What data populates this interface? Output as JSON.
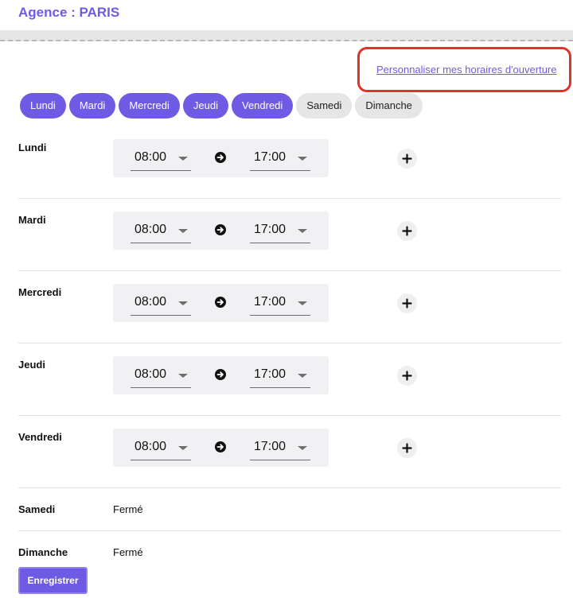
{
  "header": {
    "agency_title": "Agence : PARIS"
  },
  "customize_link": "Personnaliser mes horaires d'ouverture",
  "day_chips": [
    {
      "label": "Lundi",
      "active": true
    },
    {
      "label": "Mardi",
      "active": true
    },
    {
      "label": "Mercredi",
      "active": true
    },
    {
      "label": "Jeudi",
      "active": true
    },
    {
      "label": "Vendredi",
      "active": true
    },
    {
      "label": "Samedi",
      "active": false
    },
    {
      "label": "Dimanche",
      "active": false
    }
  ],
  "schedule": [
    {
      "day": "Lundi",
      "open": "08:00",
      "close": "17:00"
    },
    {
      "day": "Mardi",
      "open": "08:00",
      "close": "17:00"
    },
    {
      "day": "Mercredi",
      "open": "08:00",
      "close": "17:00"
    },
    {
      "day": "Jeudi",
      "open": "08:00",
      "close": "17:00"
    },
    {
      "day": "Vendredi",
      "open": "08:00",
      "close": "17:00"
    }
  ],
  "closed_days": [
    {
      "day": "Samedi",
      "status": "Fermé"
    },
    {
      "day": "Dimanche",
      "status": "Fermé"
    }
  ],
  "save_label": "Enregistrer",
  "icons": {
    "time_separator": "arrow-right-circle-icon",
    "add_slot": "plus-icon",
    "dropdown": "caret-down-icon"
  },
  "colors": {
    "accent": "#6f5be3",
    "highlight": "#e0312a",
    "chip_inactive": "#e6e6e6"
  }
}
